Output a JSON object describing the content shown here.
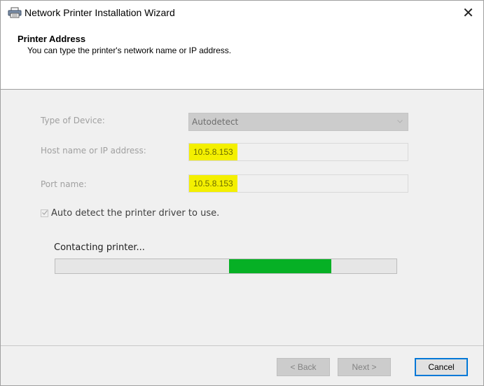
{
  "window": {
    "title": "Network Printer Installation Wizard",
    "close_symbol": "✕"
  },
  "header": {
    "title": "Printer Address",
    "subtitle": "You can type the printer's network name or IP address."
  },
  "form": {
    "device_type_label": "Type of Device:",
    "device_type_value": "Autodetect",
    "host_label": "Host name or IP address:",
    "host_value": "10.5.8.153",
    "port_label": "Port name:",
    "port_value": "10.5.8.153",
    "auto_detect_label": "Auto detect the printer driver to use.",
    "auto_detect_checked": true
  },
  "status": {
    "text": "Contacting printer...",
    "progress_type": "marquee",
    "progress_segment_start": 0.51,
    "progress_segment_end": 0.81
  },
  "buttons": {
    "back_label": "< Back",
    "next_label": "Next >",
    "cancel_label": "Cancel"
  },
  "colors": {
    "progress_fill": "#06b025",
    "highlight": "#f4f000",
    "focus_border": "#0078d7"
  },
  "icons": {
    "title_icon": "printer-icon",
    "combo_arrow": "chevron-down-icon",
    "checkbox": "checkmark-icon"
  }
}
